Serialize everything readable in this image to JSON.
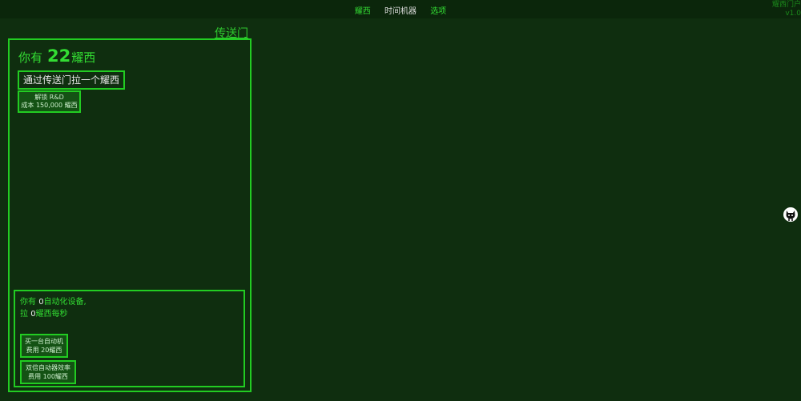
{
  "nav": {
    "tabs": [
      {
        "label": "耀西"
      },
      {
        "label": "时间机器"
      },
      {
        "label": "选项"
      }
    ]
  },
  "corner": {
    "title": "耀西门户",
    "version": "v1.0"
  },
  "portal": {
    "title": "传送门"
  },
  "resource": {
    "prefix": "你有",
    "count": "22",
    "unit": "耀西"
  },
  "actions": {
    "pull_label": "通过传送门拉一个耀西",
    "rd_line1": "解锁 R&D",
    "rd_line2": "成本 150,000 耀西"
  },
  "automation": {
    "line1_prefix": "你有",
    "devices": "0",
    "line1_suffix": "自动化设备,",
    "line2_prefix": "拉",
    "rate": "0",
    "line2_suffix": "耀西每秒",
    "buy_line1": "买一台自动机",
    "buy_line2": "费用 20耀西",
    "double_line1": "双倍自动器效率",
    "double_line2": "费用 100耀西"
  },
  "colors": {
    "background": "#0f2e0f",
    "accent": "#22cc22"
  },
  "icons": {
    "github": "octocat-icon"
  }
}
